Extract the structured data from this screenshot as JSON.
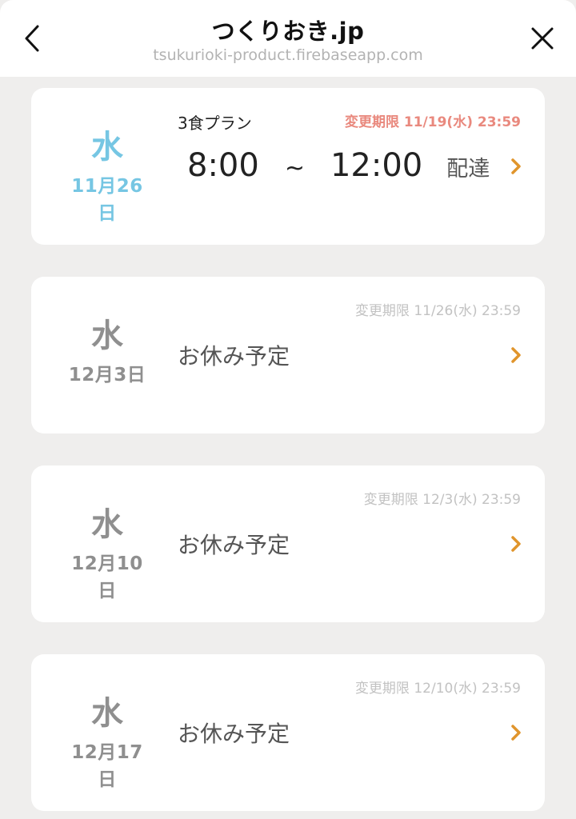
{
  "header": {
    "title": "つくりおき.jp",
    "subtitle": "tsukurioki-product.firebaseapp.com"
  },
  "accent_colors": {
    "weekday_active": "#76c6e3",
    "deadline_active": "#e9897e",
    "chevron": "#e0952c"
  },
  "deliveries": [
    {
      "weekday": "水",
      "date": "11月26日",
      "deadline": "変更期限 11/19(水) 23:59",
      "plan": "3食プラン",
      "time_start": "8:00",
      "tilde": "~",
      "time_end": "12:00",
      "delivery_label": "配達"
    },
    {
      "weekday": "水",
      "date": "12月3日",
      "deadline": "変更期限 11/26(水) 23:59",
      "status": "お休み予定"
    },
    {
      "weekday": "水",
      "date": "12月10日",
      "deadline": "変更期限 12/3(水) 23:59",
      "status": "お休み予定"
    },
    {
      "weekday": "水",
      "date": "12月17日",
      "deadline": "変更期限 12/10(水) 23:59",
      "status": "お休み予定"
    }
  ]
}
